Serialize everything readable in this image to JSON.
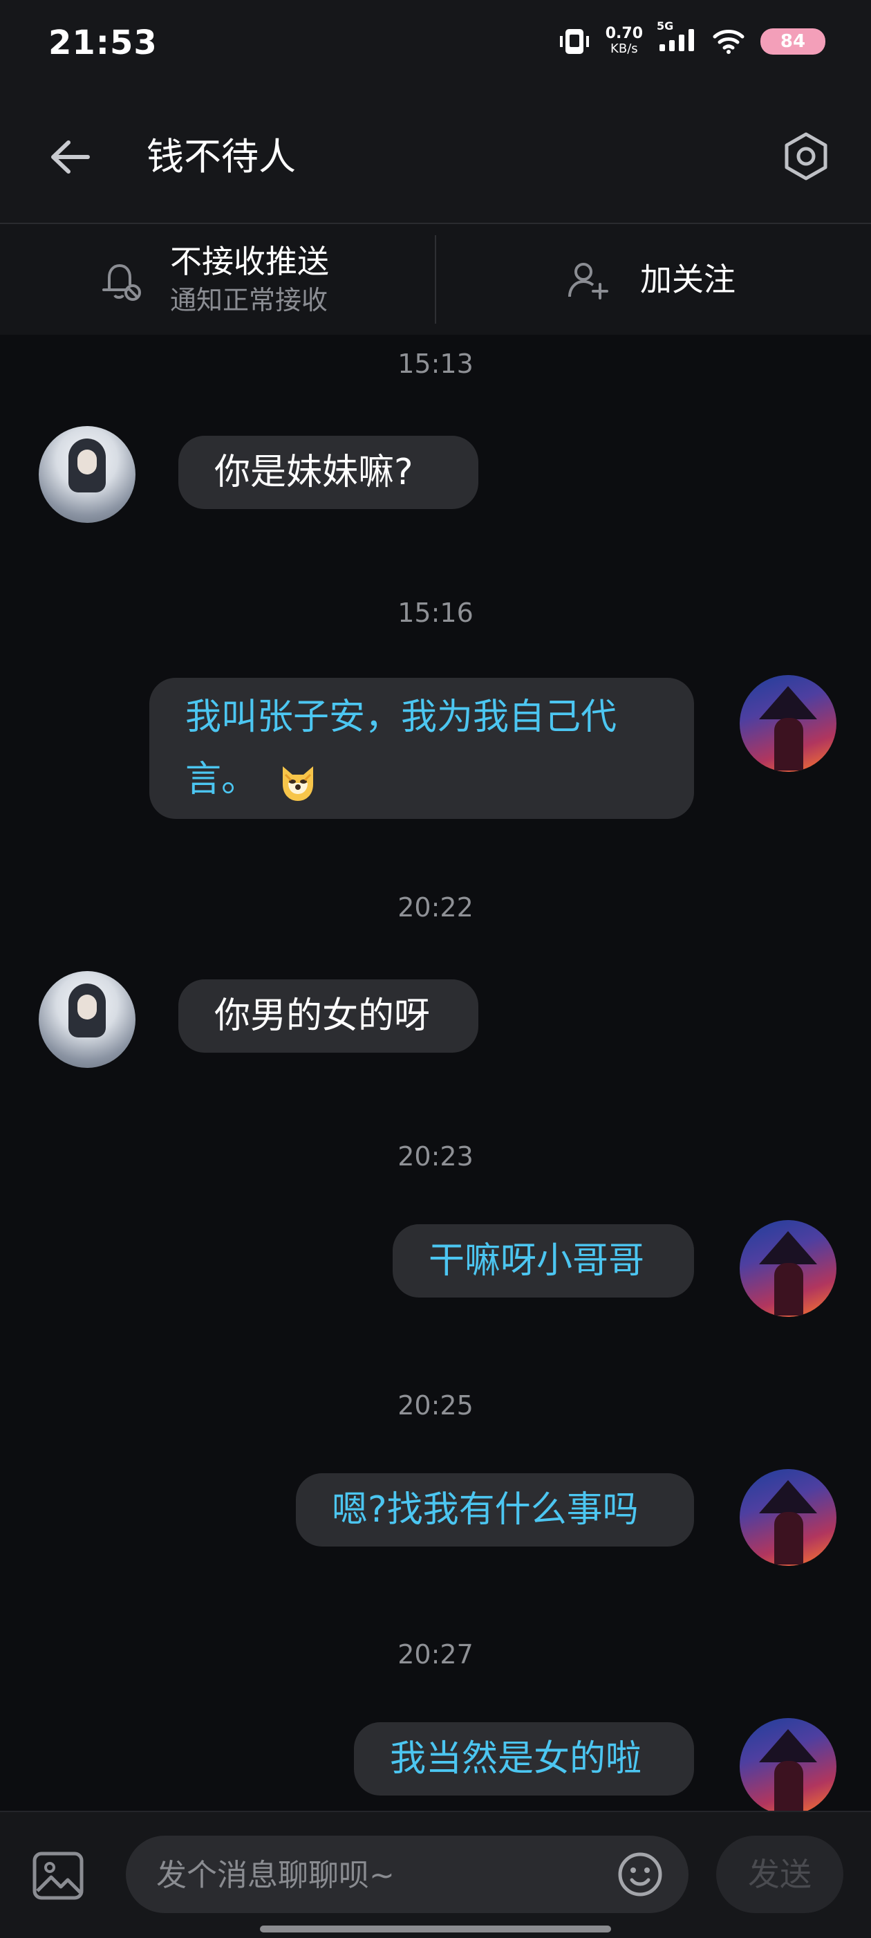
{
  "status_bar": {
    "time": "21:53",
    "network_speed_value": "0.70",
    "network_speed_unit": "KB/s",
    "network_type": "5G",
    "battery": "84"
  },
  "header": {
    "title": "钱不待人"
  },
  "actions": {
    "notify_title": "不接收推送",
    "notify_sub": "通知正常接收",
    "follow_label": "加关注"
  },
  "messages": [
    {
      "time": "15:13",
      "sender": "other",
      "text": "你是妹妹嘛?"
    },
    {
      "time": "15:16",
      "sender": "me",
      "text_line1": "我叫张子安，我为我自己代",
      "text_line2": "言。"
    },
    {
      "time": "20:22",
      "sender": "other",
      "text": "你男的女的呀"
    },
    {
      "time": "20:23",
      "sender": "me",
      "text": "干嘛呀小哥哥"
    },
    {
      "time": "20:25",
      "sender": "me",
      "text": "嗯?找我有什么事吗"
    },
    {
      "time": "20:27",
      "sender": "me",
      "text": "我当然是女的啦"
    }
  ],
  "composer": {
    "placeholder": "发个消息聊聊呗~",
    "send_label": "发送"
  },
  "colors": {
    "background": "#0c0d10",
    "bubble": "#2c2d31",
    "my_text": "#4cc6f1",
    "header": "#16171a"
  },
  "icons": {
    "back": "arrow-left-icon",
    "settings": "hexagon-settings-icon",
    "notify": "bell-off-icon",
    "follow": "add-person-icon",
    "image": "image-icon",
    "emoji": "smile-icon"
  }
}
